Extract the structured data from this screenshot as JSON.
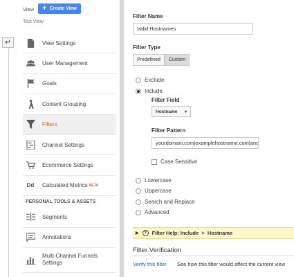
{
  "header": {
    "view_label": "View",
    "create_view_label": "Create View",
    "current_view": "Test View"
  },
  "sidebar": {
    "items": [
      {
        "label": "View Settings",
        "icon": "document-icon"
      },
      {
        "label": "User Management",
        "icon": "users-icon"
      },
      {
        "label": "Goals",
        "icon": "flag-icon"
      },
      {
        "label": "Content Grouping",
        "icon": "person-walk-icon"
      },
      {
        "label": "Filters",
        "icon": "funnel-icon",
        "active": true
      },
      {
        "label": "Channel Settings",
        "icon": "sliders-icon"
      },
      {
        "label": "Ecommerce Settings",
        "icon": "cart-icon"
      },
      {
        "label": "Calculated Metrics",
        "icon": "dd-icon",
        "badge": "BETA"
      }
    ],
    "section_header": "PERSONAL TOOLS & ASSETS",
    "tools": [
      {
        "label": "Segments",
        "icon": "segments-icon"
      },
      {
        "label": "Annotations",
        "icon": "annotation-icon"
      },
      {
        "label": "Multi-Channel Funnels Settings",
        "icon": "bar-chart-icon"
      }
    ]
  },
  "form": {
    "filter_name_label": "Filter Name",
    "filter_name_value": "Valid Hostnames",
    "filter_type_label": "Filter Type",
    "type_tabs": [
      "Predefined",
      "Custom"
    ],
    "selected_type": "Custom",
    "options_top": [
      "Exclude",
      "Include"
    ],
    "selected_option": "Include",
    "filter_field_label": "Filter Field",
    "filter_field_value": "Hostname",
    "filter_pattern_label": "Filter Pattern",
    "filter_pattern_value": "yourdomain.com|examplehostname.com|anc",
    "case_sensitive_label": "Case Sensitive",
    "options_bottom": [
      "Lowercase",
      "Uppercase",
      "Search and Replace",
      "Advanced"
    ],
    "help_text": "Filter Help: Include  >  Hostname",
    "help_question": "?"
  },
  "verification": {
    "title": "Filter Verification",
    "link": "Verify this filter",
    "description": "See how this filter would affect the current view"
  },
  "colors": {
    "accent_blue": "#4285f4",
    "active_orange": "#e3612a",
    "help_yellow": "#fff7cc"
  }
}
